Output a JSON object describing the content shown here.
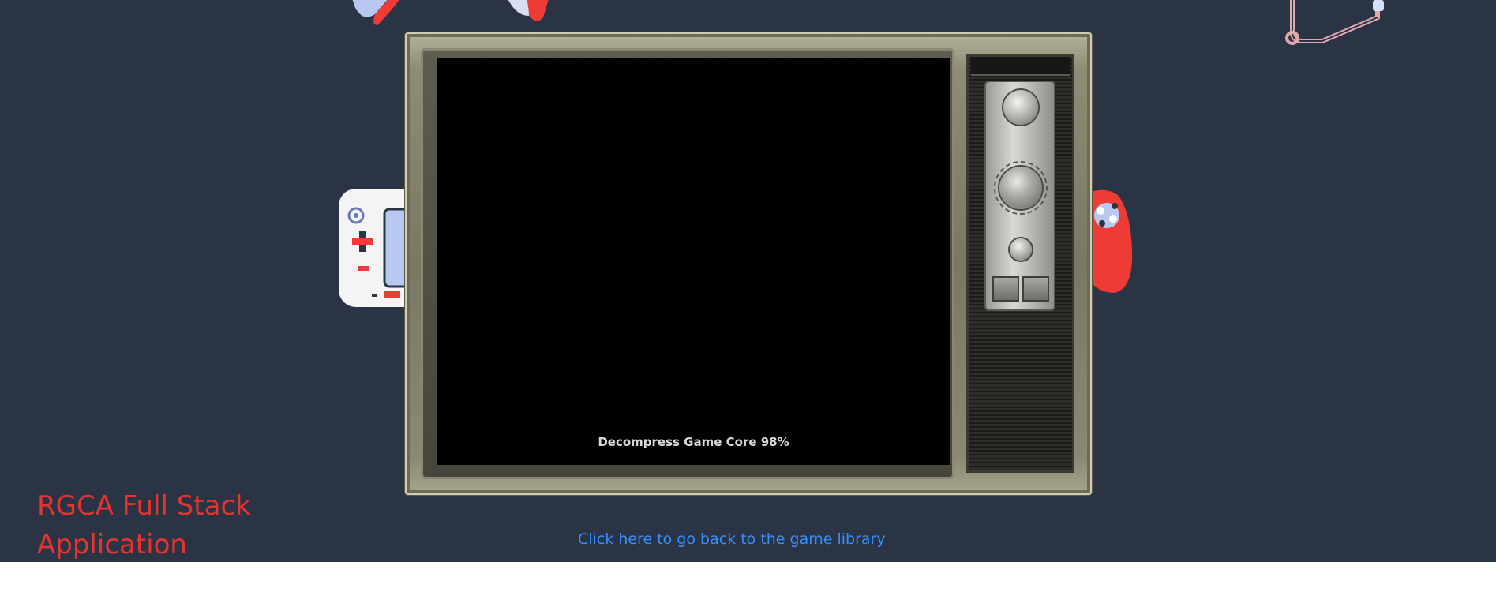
{
  "app": {
    "title": "RGCA Full Stack Application"
  },
  "game_screen": {
    "loading_text": "Decompress Game Core 98%",
    "progress_percent": 98
  },
  "footer": {
    "back_link_label": "Click here to go back to the game library"
  },
  "colors": {
    "background": "#2b3444",
    "title": "#e3342f",
    "link": "#3490ff",
    "screen": "#000000"
  },
  "decorations": [
    "gamepad-controller-icon",
    "handheld-console-icon",
    "joycon-controller-icon",
    "cable-icon"
  ]
}
